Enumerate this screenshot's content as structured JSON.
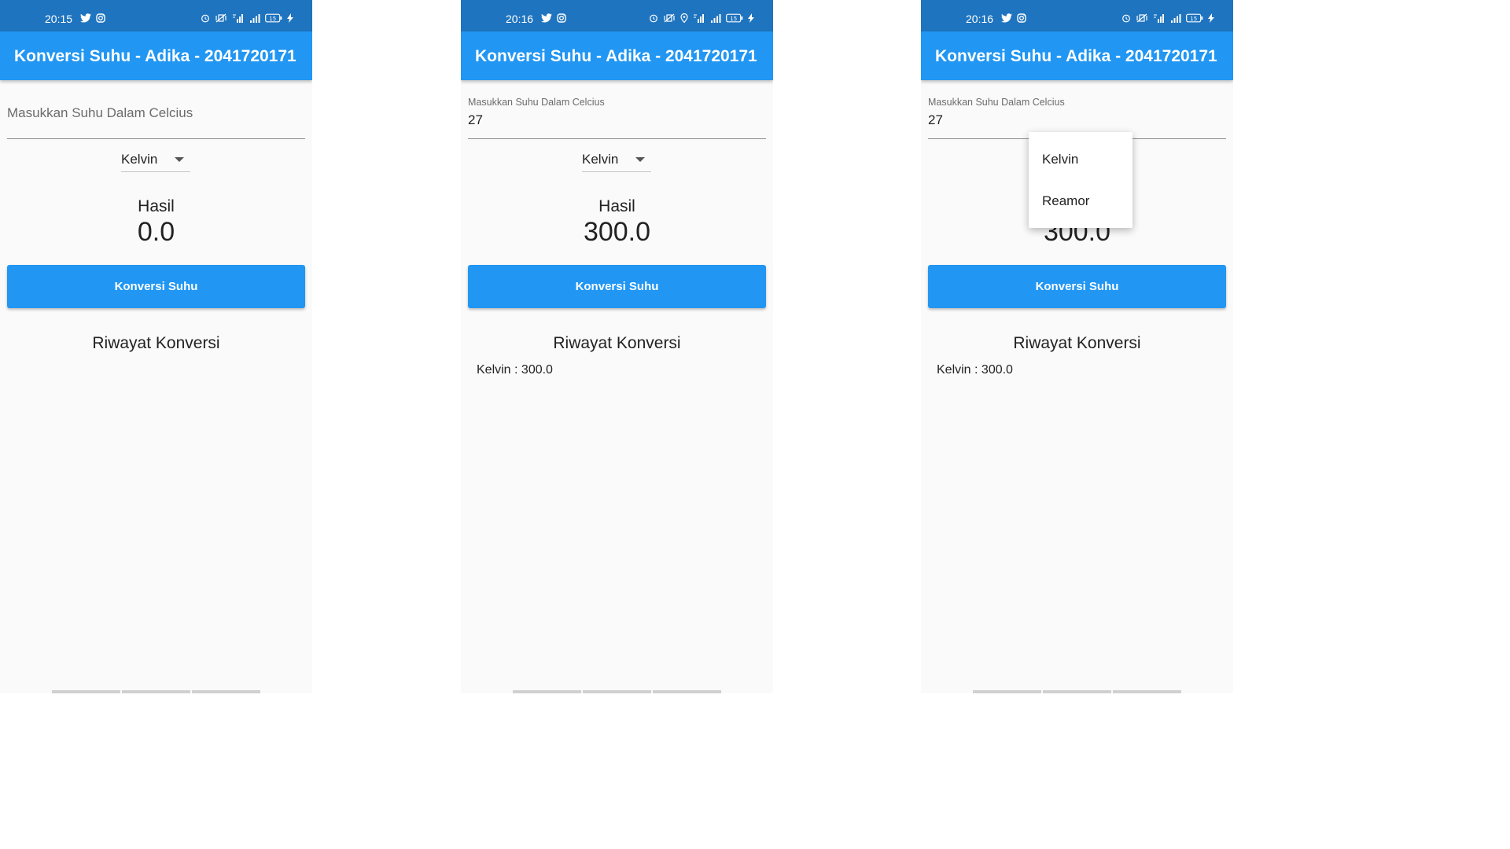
{
  "app": {
    "title": "Konversi Suhu - Adika - 2041720171",
    "colors": {
      "status_bar": "#1f74bf",
      "primary": "#2196f3",
      "background": "#fafafa"
    }
  },
  "screens": [
    {
      "status": {
        "time": "20:15",
        "battery": "15",
        "left_icons": [
          "twitter-icon",
          "instagram-icon"
        ],
        "right_icons": [
          "alarm-icon",
          "vibrate-icon",
          "mobile-data-icon",
          "signal-icon",
          "battery-icon",
          "charging-icon"
        ]
      },
      "input": {
        "placeholder": "Masukkan Suhu Dalam Celcius",
        "label": "",
        "value": ""
      },
      "dropdown": {
        "selected": "Kelvin"
      },
      "result": {
        "label": "Hasil",
        "value": "0.0"
      },
      "button": {
        "label": "Konversi Suhu"
      },
      "history": {
        "title": "Riwayat Konversi",
        "items": []
      }
    },
    {
      "status": {
        "time": "20:16",
        "battery": "15",
        "left_icons": [
          "twitter-icon",
          "instagram-icon"
        ],
        "right_icons": [
          "alarm-icon",
          "vibrate-icon",
          "location-icon",
          "mobile-data-icon",
          "signal-icon",
          "battery-icon",
          "charging-icon"
        ]
      },
      "input": {
        "placeholder": "",
        "label": "Masukkan Suhu Dalam Celcius",
        "value": "27"
      },
      "dropdown": {
        "selected": "Kelvin"
      },
      "result": {
        "label": "Hasil",
        "value": "300.0"
      },
      "button": {
        "label": "Konversi Suhu"
      },
      "history": {
        "title": "Riwayat Konversi",
        "items": [
          "Kelvin : 300.0"
        ]
      }
    },
    {
      "status": {
        "time": "20:16",
        "battery": "15",
        "left_icons": [
          "twitter-icon",
          "instagram-icon"
        ],
        "right_icons": [
          "alarm-icon",
          "vibrate-icon",
          "mobile-data-icon",
          "signal-icon",
          "battery-icon",
          "charging-icon"
        ]
      },
      "input": {
        "placeholder": "",
        "label": "Masukkan Suhu Dalam Celcius",
        "value": "27"
      },
      "result": {
        "label": "Hasil",
        "value": "300.0"
      },
      "popup_menu": {
        "options": [
          "Kelvin",
          "Reamor"
        ]
      },
      "button": {
        "label": "Konversi Suhu"
      },
      "history": {
        "title": "Riwayat Konversi",
        "items": [
          "Kelvin : 300.0"
        ]
      }
    }
  ]
}
